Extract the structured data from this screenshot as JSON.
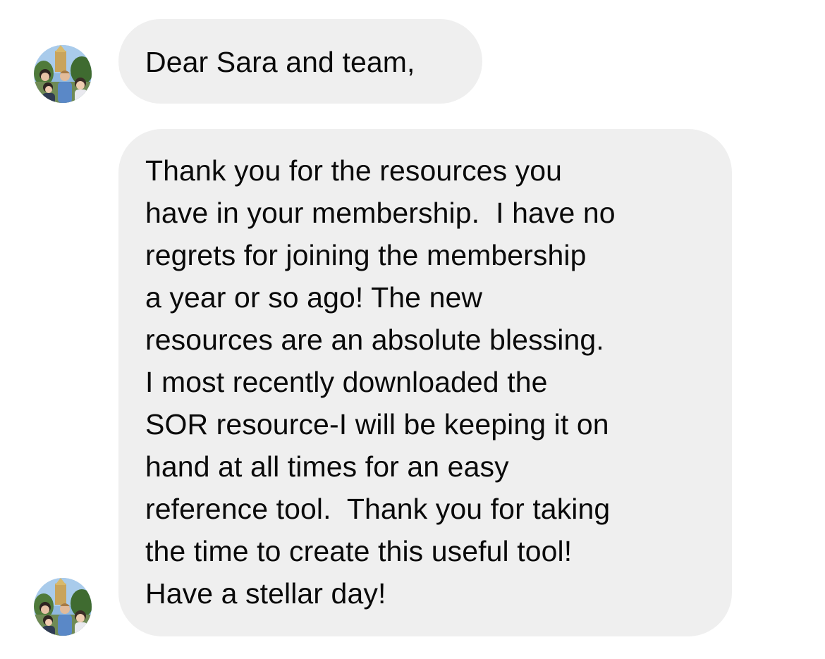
{
  "thread": {
    "messages": [
      {
        "lines": [
          "Dear Sara and team,"
        ]
      },
      {
        "lines": [
          "Thank you for the resources you",
          "have in your membership.  I have no",
          "regrets for joining the membership",
          "a year or so ago! The new",
          "resources are an absolute blessing.",
          "I most recently downloaded the",
          "SOR resource-I will be keeping it on",
          "hand at all times for an easy",
          "reference tool.  Thank you for taking",
          "the time to create this useful tool!",
          "Have a stellar day!"
        ]
      }
    ]
  },
  "colors": {
    "bubble_background": "#efefef",
    "text": "#0a0a0a",
    "page_background": "#ffffff"
  }
}
